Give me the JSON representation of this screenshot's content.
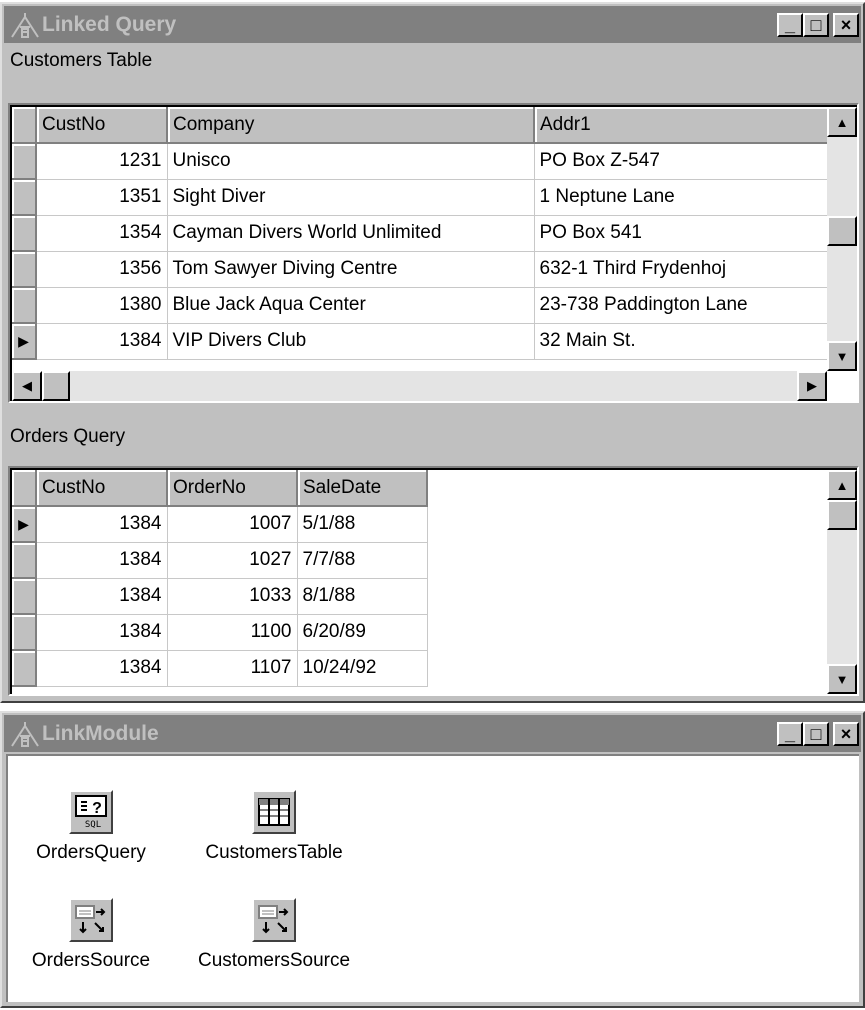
{
  "window1": {
    "title": "Linked Query",
    "customers_caption": "Customers Table",
    "orders_caption": "Orders Query",
    "customers": {
      "columns": [
        "CustNo",
        "Company",
        "Addr1"
      ],
      "rows": [
        [
          "1231",
          "Unisco",
          "PO Box Z-547"
        ],
        [
          "1351",
          "Sight Diver",
          "1 Neptune Lane"
        ],
        [
          "1354",
          "Cayman Divers World Unlimited",
          "PO Box 541"
        ],
        [
          "1356",
          "Tom Sawyer Diving Centre",
          "632-1 Third Frydenhoj"
        ],
        [
          "1380",
          "Blue Jack Aqua Center",
          "23-738 Paddington Lane"
        ],
        [
          "1384",
          "VIP Divers Club",
          "32 Main St."
        ]
      ],
      "current_row": 5
    },
    "orders": {
      "columns": [
        "CustNo",
        "OrderNo",
        "SaleDate"
      ],
      "rows": [
        [
          "1384",
          "1007",
          "5/1/88"
        ],
        [
          "1384",
          "1027",
          "7/7/88"
        ],
        [
          "1384",
          "1033",
          "8/1/88"
        ],
        [
          "1384",
          "1100",
          "6/20/89"
        ],
        [
          "1384",
          "1107",
          "10/24/92"
        ]
      ],
      "current_row": 0
    }
  },
  "window2": {
    "title": "LinkModule",
    "components": [
      {
        "label": "OrdersQuery",
        "icon": "sql-query-icon"
      },
      {
        "label": "CustomersTable",
        "icon": "table-icon"
      },
      {
        "label": "OrdersSource",
        "icon": "datasource-icon"
      },
      {
        "label": "CustomersSource",
        "icon": "datasource-icon"
      }
    ]
  },
  "title_buttons": {
    "minimize": "_",
    "maximize": "□",
    "close": "×"
  },
  "colors": {
    "titlebar_inactive": "#808080",
    "face": "#c0c0c0",
    "title_text": "#c0c0c0"
  }
}
